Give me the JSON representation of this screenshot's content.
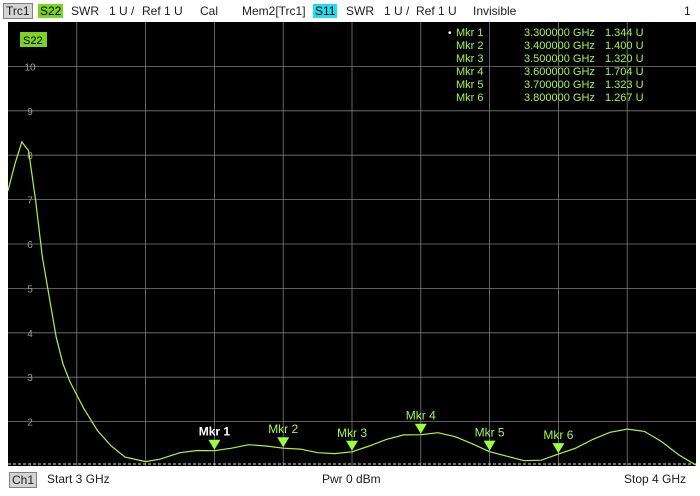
{
  "header": {
    "trace1": {
      "name": "Trc1",
      "param": "S22",
      "format": "SWR",
      "scale": "1 U /",
      "ref": "Ref 1 U",
      "cal": "Cal"
    },
    "trace2": {
      "name": "Mem2[Trc1]",
      "param": "S11",
      "format": "SWR",
      "scale": "1 U /",
      "ref": "Ref 1 U",
      "state": "Invisible"
    },
    "window_number": "1"
  },
  "footer": {
    "channel": "Ch1",
    "start": "Start 3 GHz",
    "power": "Pwr 0 dBm",
    "stop": "Stop 4 GHz"
  },
  "colors": {
    "trace": "#b8f040",
    "marker": "#9bff3b",
    "text": "#a7f24b",
    "grid": "#7a7a7a",
    "background": "#000000",
    "trace_label_bg": "#7cd322",
    "memory_label_bg": "#25d9ef"
  },
  "chart_data": {
    "type": "line",
    "trace_label": "S22",
    "xlim": [
      3.0,
      4.0
    ],
    "ylim": [
      1,
      11
    ],
    "yticks": [
      "1",
      "2",
      "3",
      "4",
      "5",
      "6",
      "7",
      "8",
      "9",
      "10"
    ],
    "grid": true,
    "x": [
      3.0,
      3.01,
      3.02,
      3.03,
      3.04,
      3.05,
      3.06,
      3.07,
      3.08,
      3.09,
      3.1,
      3.11,
      3.12,
      3.13,
      3.15,
      3.17,
      3.2,
      3.22,
      3.25,
      3.275,
      3.3,
      3.325,
      3.35,
      3.375,
      3.4,
      3.425,
      3.45,
      3.475,
      3.5,
      3.525,
      3.55,
      3.575,
      3.6,
      3.625,
      3.65,
      3.675,
      3.7,
      3.725,
      3.75,
      3.775,
      3.8,
      3.825,
      3.85,
      3.875,
      3.9,
      3.925,
      3.95,
      3.975,
      4.0
    ],
    "y": [
      7.2,
      7.8,
      8.3,
      8.1,
      7.0,
      5.7,
      4.8,
      3.9,
      3.3,
      2.9,
      2.6,
      2.3,
      2.05,
      1.8,
      1.45,
      1.2,
      1.1,
      1.15,
      1.3,
      1.35,
      1.344,
      1.4,
      1.48,
      1.45,
      1.4,
      1.38,
      1.3,
      1.28,
      1.32,
      1.45,
      1.6,
      1.7,
      1.704,
      1.75,
      1.66,
      1.5,
      1.323,
      1.22,
      1.12,
      1.13,
      1.267,
      1.4,
      1.6,
      1.76,
      1.83,
      1.78,
      1.55,
      1.25,
      1.02
    ],
    "markers": [
      {
        "label": "Mkr 1",
        "name": "Mkr 1",
        "x": 3.3,
        "freq": "3.300000 GHz",
        "value": "1.344 U",
        "y": 1.344,
        "active": true
      },
      {
        "label": "Mkr 2",
        "name": "Mkr 2",
        "x": 3.4,
        "freq": "3.400000 GHz",
        "value": "1.400 U",
        "y": 1.4,
        "active": false
      },
      {
        "label": "Mkr 3",
        "name": "Mkr 3",
        "x": 3.5,
        "freq": "3.500000 GHz",
        "value": "1.320 U",
        "y": 1.32,
        "active": false
      },
      {
        "label": "Mkr 4",
        "name": "Mkr 4",
        "x": 3.6,
        "freq": "3.600000 GHz",
        "value": "1.704 U",
        "y": 1.704,
        "active": false
      },
      {
        "label": "Mkr 5",
        "name": "Mkr 5",
        "x": 3.7,
        "freq": "3.700000 GHz",
        "value": "1.323 U",
        "y": 1.323,
        "active": false
      },
      {
        "label": "Mkr 6",
        "name": "Mkr 6",
        "x": 3.8,
        "freq": "3.800000 GHz",
        "value": "1.267 U",
        "y": 1.267,
        "active": false
      }
    ]
  }
}
